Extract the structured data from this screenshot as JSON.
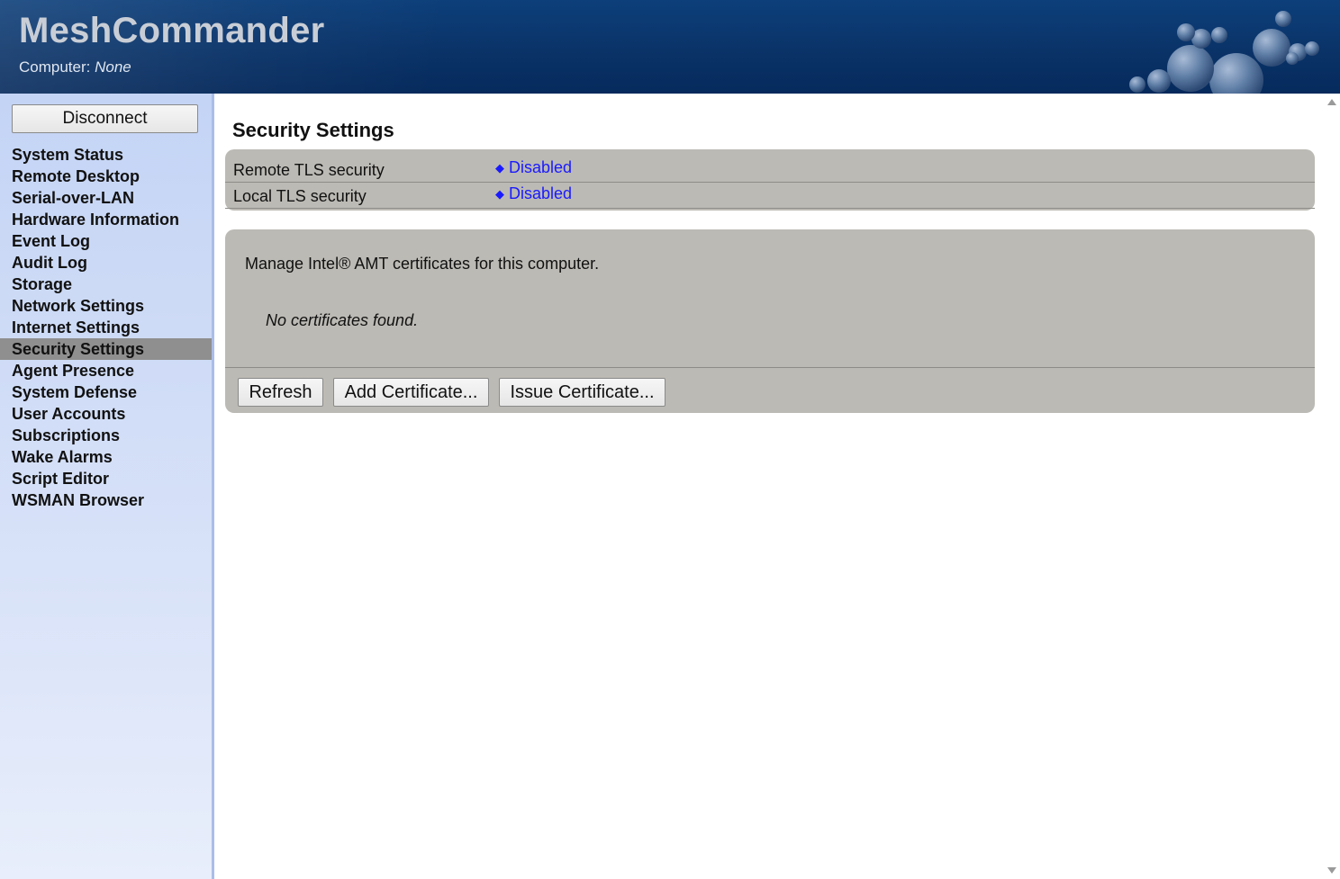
{
  "header": {
    "app_title": "MeshCommander",
    "computer_label": "Computer:",
    "computer_value": "None"
  },
  "sidebar": {
    "disconnect_label": "Disconnect",
    "items": [
      {
        "label": "System Status"
      },
      {
        "label": "Remote Desktop"
      },
      {
        "label": "Serial-over-LAN"
      },
      {
        "label": "Hardware Information"
      },
      {
        "label": "Event Log"
      },
      {
        "label": "Audit Log"
      },
      {
        "label": "Storage"
      },
      {
        "label": "Network Settings"
      },
      {
        "label": "Internet Settings"
      },
      {
        "label": "Security Settings",
        "active": true
      },
      {
        "label": "Agent Presence"
      },
      {
        "label": "System Defense"
      },
      {
        "label": "User Accounts"
      },
      {
        "label": "Subscriptions"
      },
      {
        "label": "Wake Alarms"
      },
      {
        "label": "Script Editor"
      },
      {
        "label": "WSMAN Browser"
      }
    ]
  },
  "main": {
    "title": "Security Settings",
    "tls": [
      {
        "label": "Remote TLS security",
        "value": "Disabled"
      },
      {
        "label": "Local TLS security",
        "value": "Disabled"
      }
    ],
    "certificates": {
      "description": "Manage Intel® AMT certificates for this computer.",
      "empty_text": "No certificates found.",
      "refresh_label": "Refresh",
      "add_label": "Add Certificate...",
      "issue_label": "Issue Certificate..."
    }
  },
  "colors": {
    "header_bg": "#0a3368",
    "sidebar_bg": "#c4d4f5",
    "panel_bg": "#bcbab4",
    "link": "#1a1aff",
    "active_nav": "#8f8f8f"
  },
  "icons": {
    "value_marker": "diamond-icon",
    "logo": "bubbles-logo-icon"
  }
}
